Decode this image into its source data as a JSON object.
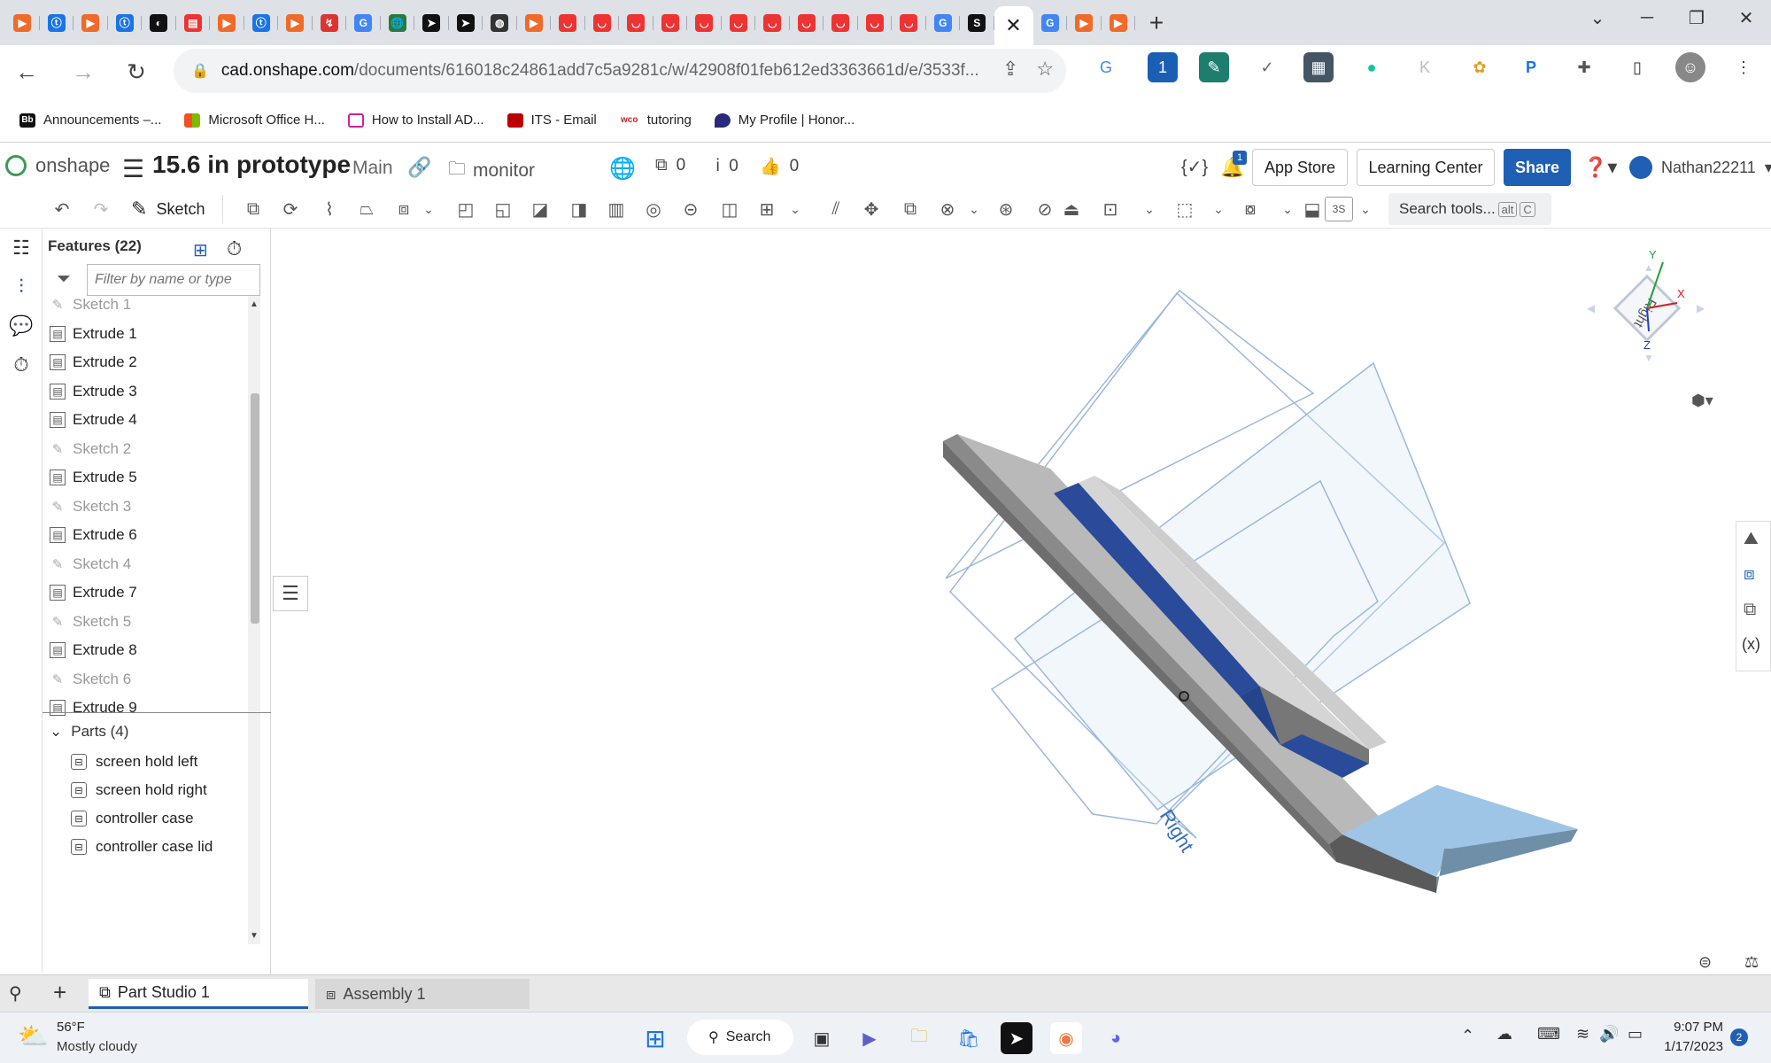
{
  "browser": {
    "url_domain": "cad.onshape.com",
    "url_path": "/documents/616018c24861add7c5a9281c/w/42908f01feb612ed3363661d/e/3533f...",
    "bookmarks": [
      {
        "label": "Announcements –...",
        "icon_text": "Bb",
        "color": "#111111"
      },
      {
        "label": "Microsoft Office H...",
        "icon_text": "",
        "color": "#e74c1c"
      },
      {
        "label": "How to Install AD...",
        "icon_text": "",
        "color": "#cc2299"
      },
      {
        "label": "ITS - Email",
        "icon_text": "",
        "color": "#bb0000"
      },
      {
        "label": "tutoring",
        "icon_text": "wco",
        "color": "#cc2222"
      },
      {
        "label": "My Profile | Honor...",
        "icon_text": "",
        "color": "#2a2a7a"
      }
    ]
  },
  "onshape": {
    "app_name": "onshape",
    "doc_title": "15.6 in prototype",
    "branch": "Main",
    "folder": "monitor",
    "copies_count": "0",
    "info_count": "0",
    "likes_count": "0",
    "notification_count": "1",
    "app_store": "App Store",
    "learning_center": "Learning Center",
    "share": "Share",
    "user": "Nathan22211",
    "sketch_label": "Sketch",
    "search_tools": "Search tools...",
    "search_kbd1": "alt",
    "search_kbd2": "C",
    "tb_3s": "3S"
  },
  "features": {
    "header": "Features (22)",
    "filter_placeholder": "Filter by name or type",
    "items": [
      {
        "label": "Sketch 1",
        "type": "sketch"
      },
      {
        "label": "Extrude 1",
        "type": "extrude"
      },
      {
        "label": "Extrude 2",
        "type": "extrude"
      },
      {
        "label": "Extrude 3",
        "type": "extrude"
      },
      {
        "label": "Extrude 4",
        "type": "extrude"
      },
      {
        "label": "Sketch 2",
        "type": "sketch"
      },
      {
        "label": "Extrude 5",
        "type": "extrude"
      },
      {
        "label": "Sketch 3",
        "type": "sketch"
      },
      {
        "label": "Extrude 6",
        "type": "extrude"
      },
      {
        "label": "Sketch 4",
        "type": "sketch"
      },
      {
        "label": "Extrude 7",
        "type": "extrude"
      },
      {
        "label": "Sketch 5",
        "type": "sketch"
      },
      {
        "label": "Extrude 8",
        "type": "extrude"
      },
      {
        "label": "Sketch 6",
        "type": "sketch"
      },
      {
        "label": "Extrude 9",
        "type": "extrude"
      }
    ],
    "parts_header": "Parts (4)",
    "parts": [
      "screen hold left",
      "screen hold right",
      "controller case",
      "controller case lid"
    ]
  },
  "viewport": {
    "plane_label": "Right",
    "cube_label": "Right",
    "axis_y": "Y",
    "axis_x": "X",
    "axis_z": "Z"
  },
  "bottom_tabs": {
    "part_studio": "Part Studio 1",
    "assembly": "Assembly 1"
  },
  "taskbar": {
    "temp": "56°F",
    "weather": "Mostly cloudy",
    "search": "Search",
    "time": "9:07 PM",
    "date": "1/17/2023",
    "notif_count": "2"
  },
  "colors": {
    "accent": "#1f5fb4",
    "onshape_green": "#3e9a56",
    "part_blue": "#2a4a9a",
    "plane_blue": "#7aa9d6"
  }
}
